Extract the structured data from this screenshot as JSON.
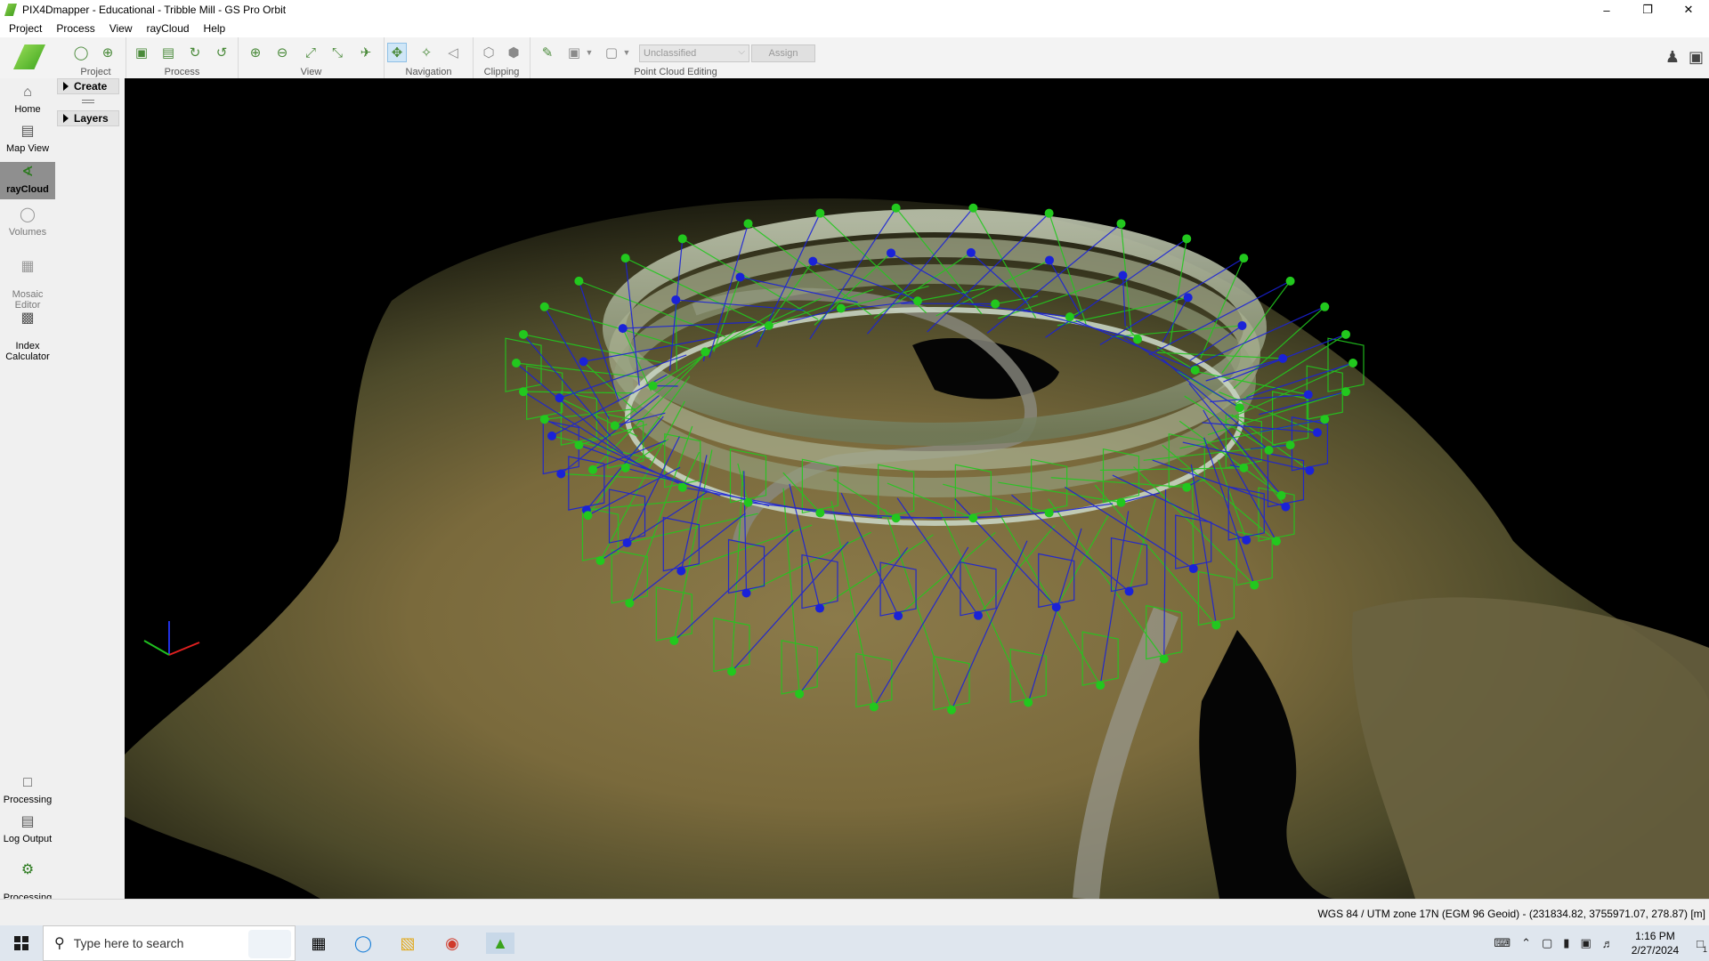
{
  "window": {
    "title": "PIX4Dmapper - Educational - Tribble Mill - GS Pro Orbit",
    "controls": [
      "minimize-icon",
      "restore-icon",
      "close-icon"
    ]
  },
  "menu": [
    "Project",
    "Process",
    "View",
    "rayCloud",
    "Help"
  ],
  "ribbon": {
    "groups": {
      "project": "Project",
      "process": "Process",
      "view": "View",
      "navigation": "Navigation",
      "clipping": "Clipping",
      "point_cloud_editing": "Point Cloud Editing"
    },
    "classification_select": "Unclassified",
    "assign_button": "Assign"
  },
  "sidebar": {
    "top": [
      {
        "label": "Home",
        "icon": "home-icon"
      },
      {
        "label": "Map View",
        "icon": "map-icon"
      },
      {
        "label": "rayCloud",
        "icon": "raycloud-icon"
      },
      {
        "label": "Volumes",
        "icon": "volumes-icon"
      },
      {
        "label": "Mosaic\nEditor",
        "icon": "mosaic-icon"
      },
      {
        "label": "Index\nCalculator",
        "icon": "index-icon"
      }
    ],
    "bottom": [
      {
        "label": "Processing",
        "icon": "processing-icon"
      },
      {
        "label": "Log Output",
        "icon": "log-icon"
      },
      {
        "label": "Processing\nOptions",
        "icon": "gear-icon"
      }
    ]
  },
  "panel": {
    "create": "Create",
    "layers": "Layers"
  },
  "viewport": {
    "axes_colors": {
      "x": "#e02020",
      "y": "#20c020",
      "z": "#2030e0"
    },
    "camera_color_green": "#22c81e",
    "camera_color_blue": "#1a22d8"
  },
  "status": {
    "coords": "WGS 84 / UTM zone 17N (EGM 96 Geoid) - (231834.82, 3755971.07, 278.87) [m]"
  },
  "taskbar": {
    "search_placeholder": "Type here to search",
    "time": "1:16 PM",
    "date": "2/27/2024",
    "notification_count": "1"
  }
}
